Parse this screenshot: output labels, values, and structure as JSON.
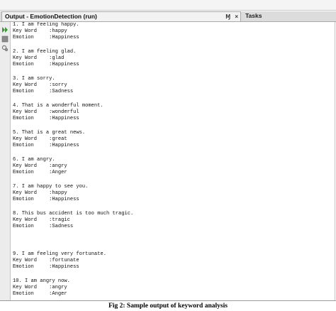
{
  "window": {
    "output_tab_title": "Output - EmotionDetection (run)",
    "tab_controls": {
      "pin": "Ɱ",
      "close": "×"
    },
    "tasks_tab_title": "Tasks"
  },
  "toolbar": {
    "icons": [
      "rerun-icon",
      "stop-icon",
      "settings-icon"
    ]
  },
  "output": {
    "entries": [
      {
        "sentence": "1. I am feeling happy.",
        "keyword": "Key Word    :happy",
        "emotion": "Emotion     :Happiness"
      },
      {
        "sentence": "2. I am feeling glad.",
        "keyword": "Key Word    :glad",
        "emotion": "Emotion     :Happiness"
      },
      {
        "sentence": "3. I am sorry.",
        "keyword": "Key Word    :sorry",
        "emotion": "Emotion     :Sadness"
      },
      {
        "sentence": "4. That is a wonderful moment.",
        "keyword": "Key Word    :wonderful",
        "emotion": "Emotion     :Happiness"
      },
      {
        "sentence": "5. That is a great news.",
        "keyword": "Key Word    :great",
        "emotion": "Emotion     :Happiness"
      },
      {
        "sentence": "6. I am angry.",
        "keyword": "Key Word    :angry",
        "emotion": "Emotion     :Anger"
      },
      {
        "sentence": "7. I am happy to see you.",
        "keyword": "Key Word    :happy",
        "emotion": "Emotion     :Happiness"
      },
      {
        "sentence": "8. This bus accident is too much tragic.",
        "keyword": "Key Word    :tragic",
        "emotion": "Emotion     :Sadness"
      },
      {
        "sentence": "9. I am feeling very fortunate.",
        "keyword": "Key Word    :fortunate",
        "emotion": "Emotion     :Happiness"
      },
      {
        "sentence": "10. I am angry now.",
        "keyword": "Key Word    :angry",
        "emotion": "Emotion     :Anger"
      }
    ]
  },
  "caption": "Fig 2: Sample output of keyword analysis",
  "colors": {
    "rerun_green": "#2e9e2e",
    "stop_gray": "#8a8a8a"
  }
}
